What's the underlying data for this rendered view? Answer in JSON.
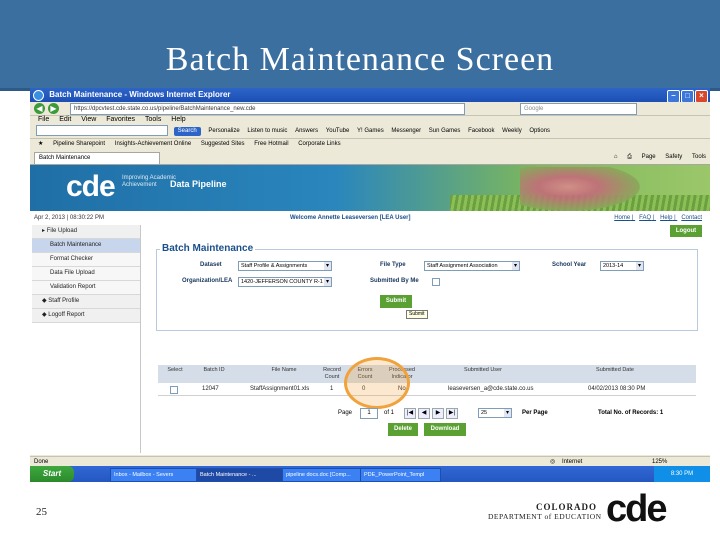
{
  "slide": {
    "title": "Batch Maintenance Screen",
    "number": "25",
    "footer_logo_line1": "COLORADO",
    "footer_logo_line2": "DEPARTMENT of EDUCATION",
    "footer_logo_mark": "cde"
  },
  "browser": {
    "window_title": "Batch Maintenance - Windows Internet Explorer",
    "address": "https://dpcvtest.cde.state.co.us/pipeline/BatchMaintenance_new.cde",
    "search_placeholder": "Google",
    "menu": [
      "File",
      "Edit",
      "View",
      "Favorites",
      "Tools",
      "Help"
    ],
    "toolbar_search_label": "Search",
    "toolbar_items": [
      "Personalize",
      "Listen to music",
      "Answers",
      "YouTube",
      "Y! Games",
      "Messenger",
      "Sun Games",
      "Facebook",
      "Weekly",
      "Options"
    ],
    "favorites_items": [
      "Pipeline Sharepoint",
      "Insights-Achievement Online",
      "Suggested Sites",
      "Free Hotmail",
      "Corporate Links"
    ],
    "tab_label": "Batch Maintenance",
    "command_items": [
      "Page",
      "Safety",
      "Tools"
    ],
    "status_left": "Done",
    "status_zone": "Internet",
    "zoom": "125%"
  },
  "app": {
    "logo": "cde",
    "tagline": "Improving Academic Achievement",
    "product": "Data Pipeline",
    "datetime": "Apr 2, 2013 | 08:30:22 PM",
    "welcome": "Welcome  Annette Leaseversen [LEA User]",
    "top_links": [
      "Home",
      "FAQ",
      "Help",
      "Contact"
    ],
    "logout_label": "Logout",
    "sidebar": [
      {
        "label": "File Upload",
        "level": 0
      },
      {
        "label": "Batch Maintenance",
        "level": 1
      },
      {
        "label": "Format Checker",
        "level": 1
      },
      {
        "label": "Data File Upload",
        "level": 1
      },
      {
        "label": "Validation Report",
        "level": 1
      },
      {
        "label": "Staff Profile",
        "level": 0
      },
      {
        "label": "Logoff Report",
        "level": 0
      }
    ],
    "section_title": "Batch Maintenance",
    "form": {
      "dataset_label": "Dataset",
      "dataset_value": "Staff Profile & Assignments",
      "filetype_label": "File Type",
      "filetype_value": "Staff Assignment Association",
      "schoolyear_label": "School Year",
      "schoolyear_value": "2013-14",
      "org_label": "Organization/LEA",
      "org_value": "1420-JEFFERSON COUNTY R-1",
      "submitted_by_me_label": "Submitted By Me",
      "submit_label": "Submit",
      "submit_tooltip": "Submit"
    },
    "table": {
      "headers": [
        "Select",
        "Batch ID",
        "File Name",
        "Record Count",
        "Errors Count",
        "Processed Indicator",
        "Submitted User",
        "Submitted Date"
      ],
      "rows": [
        [
          "",
          "12047",
          "StaffAssignment01.xls",
          "1",
          "0",
          "No",
          "leaseversen_a@cde.state.co.us",
          "04/02/2013 08:30 PM"
        ]
      ]
    },
    "pager": {
      "page_label": "Page",
      "page_value": "1",
      "of_label": "of 1",
      "page_size": "25",
      "per_page_label": "Per Page",
      "total_label": "Total No. of Records: 1"
    },
    "delete_label": "Delete",
    "download_label": "Download"
  },
  "taskbar": {
    "start_label": "Start",
    "items": [
      "Inbox - Mailbox - Severs",
      "Batch Maintenance - ...",
      "pipeline docs.doc [Comp...",
      "PDE_PowerPoint_Templ"
    ],
    "clock": "8:30 PM"
  },
  "colors": {
    "header_blue": "#3b6fa0",
    "accent_green": "#5aa033",
    "highlight_orange": "#f0a23c"
  }
}
